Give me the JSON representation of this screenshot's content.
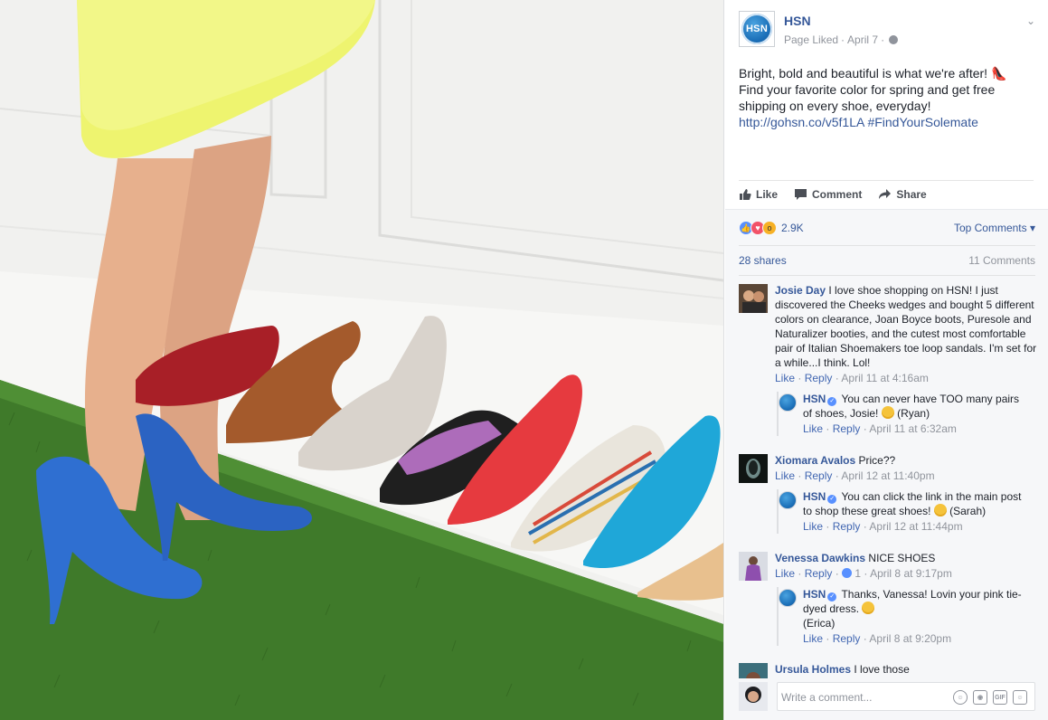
{
  "post": {
    "page_name": "HSN",
    "avatar_text": "HSN",
    "meta_status": "Page Liked",
    "meta_sep": "·",
    "meta_date": "April 7",
    "meta_sep2": "·",
    "text_line1": "Bright, bold and beautiful is what we're after! 👠",
    "text_line2": "Find your favorite color for spring and get free shipping on every shoe, everyday!",
    "link": "http://gohsn.co/v5f1LA",
    "hashtag": "#FindYourSolemate"
  },
  "actions": {
    "like": "Like",
    "comment": "Comment",
    "share": "Share"
  },
  "reactions": {
    "count": "2.9K",
    "sort_label": "Top Comments",
    "shares": "28 shares",
    "comments_count": "11 Comments"
  },
  "comments": [
    {
      "author": "Josie Day",
      "text": "I love shoe shopping on HSN! I just discovered the Cheeks wedges and bought 5 different colors on clearance, Joan Boyce boots, Puresole and Naturalizer booties, and the cutest most comfortable pair of Italian Shoemakers toe loop sandals. I'm set for a while...I think. Lol!",
      "like": "Like",
      "reply": "Reply",
      "time": "April 11 at 4:16am",
      "response": {
        "author": "HSN",
        "text": "You can never have TOO many pairs of shoes, Josie!",
        "sign": "(Ryan)",
        "like": "Like",
        "reply": "Reply",
        "time": "April 11 at 6:32am"
      }
    },
    {
      "author": "Xiomara Avalos",
      "text": "Price??",
      "like": "Like",
      "reply": "Reply",
      "time": "April 12 at 11:40pm",
      "response": {
        "author": "HSN",
        "text": "You can click the link in the main post to shop these great shoes!",
        "sign": "(Sarah)",
        "like": "Like",
        "reply": "Reply",
        "time": "April 12 at 11:44pm"
      }
    },
    {
      "author": "Venessa Dawkins",
      "text": "NICE SHOES",
      "like": "Like",
      "reply": "Reply",
      "likes": "1",
      "time": "April 8 at 9:17pm",
      "response": {
        "author": "HSN",
        "text": "Thanks, Vanessa! Lovin your pink tie-dyed dress.",
        "sign": "(Erica)",
        "like": "Like",
        "reply": "Reply",
        "time": "April 8 at 9:20pm"
      }
    },
    {
      "author": "Ursula Holmes",
      "text": "I love those"
    }
  ],
  "composer": {
    "placeholder": "Write a comment..."
  },
  "colors": {
    "facebook_blue": "#365899",
    "muted": "#90949c",
    "panel_bg": "#f6f7f9"
  }
}
